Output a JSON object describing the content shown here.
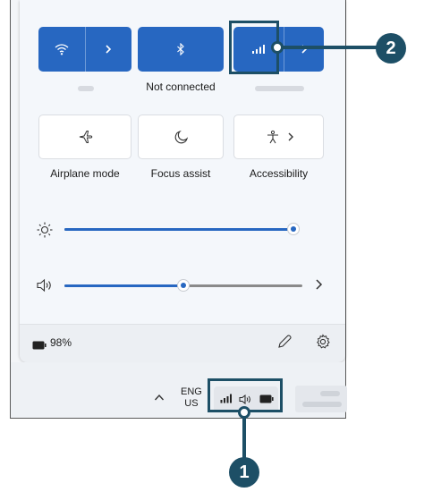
{
  "quick_settings": {
    "tiles_row1": [
      {
        "name": "wifi",
        "label": "",
        "active": true
      },
      {
        "name": "bluetooth",
        "label": "Not connected",
        "active": true
      },
      {
        "name": "cellular",
        "label": "",
        "active": true
      }
    ],
    "tiles_row2": [
      {
        "name": "airplane-mode",
        "label": "Airplane mode",
        "active": false
      },
      {
        "name": "focus-assist",
        "label": "Focus assist",
        "active": false
      },
      {
        "name": "accessibility",
        "label": "Accessibility",
        "active": false
      }
    ],
    "brightness_level": 1.0,
    "volume_level": 0.5
  },
  "footer": {
    "battery_percent": "98%"
  },
  "taskbar": {
    "language_line1": "ENG",
    "language_line2": "US"
  },
  "callouts": {
    "one": "1",
    "two": "2"
  },
  "colors": {
    "accent": "#2767c1",
    "callout": "#1d4f66"
  }
}
